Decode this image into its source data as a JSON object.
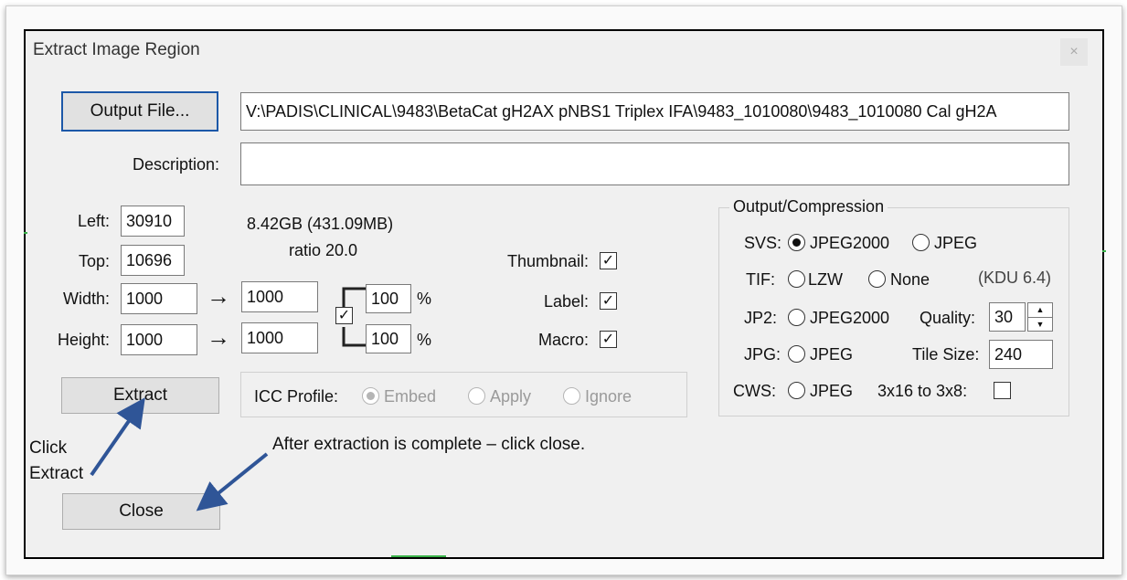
{
  "window": {
    "title": "Extract Image Region",
    "close_glyph": "×"
  },
  "output_file": {
    "button_label": "Output File...",
    "path": "V:\\PADIS\\CLINICAL\\9483\\BetaCat gH2AX pNBS1 Triplex IFA\\9483_1010080\\9483_1010080 Cal gH2A"
  },
  "description": {
    "label": "Description:",
    "value": ""
  },
  "region": {
    "left_label": "Left:",
    "left_value": "30910",
    "top_label": "Top:",
    "top_value": "10696",
    "width_label": "Width:",
    "width_value": "1000",
    "width_out": "1000",
    "width_pct": "100",
    "height_label": "Height:",
    "height_value": "1000",
    "height_out": "1000",
    "height_pct": "100",
    "percent_sign": "%",
    "arrow_glyph": "→",
    "size_info": "8.42GB (431.09MB)",
    "ratio_info": "ratio 20.0",
    "lock_checked": true
  },
  "include": {
    "thumbnail_label": "Thumbnail:",
    "thumbnail_checked": true,
    "label_label": "Label:",
    "label_checked": true,
    "macro_label": "Macro:",
    "macro_checked": true,
    "check_glyph": "✓"
  },
  "icc": {
    "label": "ICC Profile:",
    "options": [
      "Embed",
      "Apply",
      "Ignore"
    ],
    "selected": "Embed",
    "disabled": true
  },
  "compression": {
    "group_title": "Output/Compression",
    "svs_label": "SVS:",
    "svs_options": [
      "JPEG2000",
      "JPEG"
    ],
    "svs_selected": "JPEG2000",
    "tif_label": "TIF:",
    "tif_options": [
      "LZW",
      "None"
    ],
    "kdu_version": "(KDU 6.4)",
    "jp2_label": "JP2:",
    "jp2_option": "JPEG2000",
    "quality_label": "Quality:",
    "quality_value": "30",
    "spin_up": "▲",
    "spin_down": "▼",
    "jpg_label": "JPG:",
    "jpg_option": "JPEG",
    "tile_size_label": "Tile Size:",
    "tile_size_value": "240",
    "cws_label": "CWS:",
    "cws_option": "JPEG",
    "convert_label": "3x16 to 3x8:",
    "convert_checked": false
  },
  "actions": {
    "extract_label": "Extract",
    "close_label": "Close"
  },
  "annotations": {
    "click_extract_line1": "Click",
    "click_extract_line2": "Extract",
    "after_extraction": "After extraction is complete – click close."
  },
  "colors": {
    "annotation_arrow": "#2f5597",
    "default_button_border": "#1c58a8",
    "dialog_bg": "#f0f0f0"
  }
}
